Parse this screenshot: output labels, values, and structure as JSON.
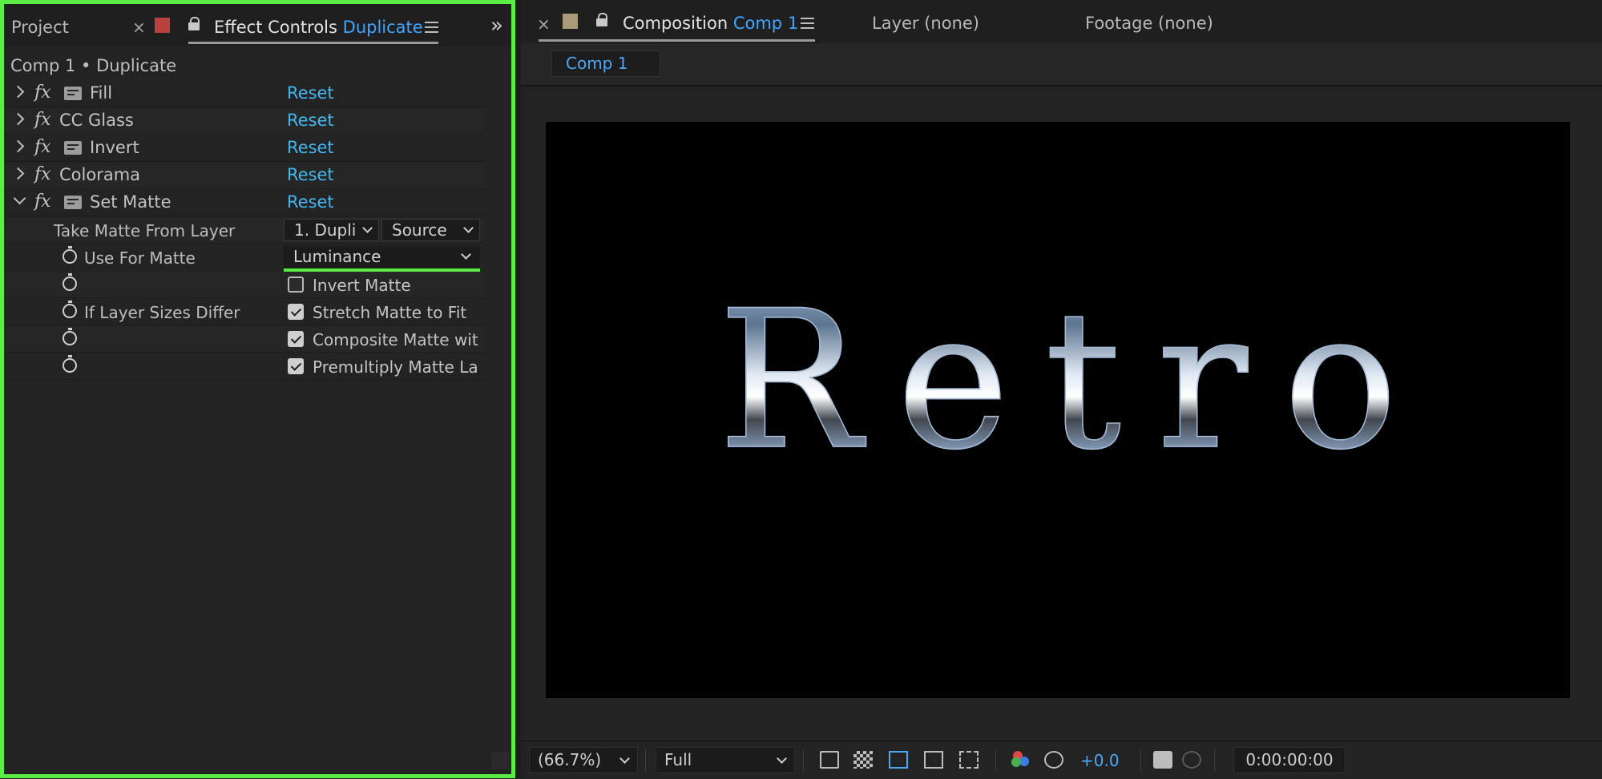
{
  "left_panel": {
    "tabs": {
      "project": "Project",
      "close_glyph": "×",
      "label_color": "#b8423f",
      "effect_controls_prefix": "Effect Controls",
      "effect_controls_layer": "Duplicate",
      "overflow_glyph": "»"
    },
    "header": "Comp 1 • Duplicate",
    "effects": [
      {
        "name": "Fill",
        "reset": "Reset",
        "expanded": false,
        "has_badge": true
      },
      {
        "name": "CC Glass",
        "reset": "Reset",
        "expanded": false,
        "has_badge": false
      },
      {
        "name": "Invert",
        "reset": "Reset",
        "expanded": false,
        "has_badge": true
      },
      {
        "name": "Colorama",
        "reset": "Reset",
        "expanded": false,
        "has_badge": false
      },
      {
        "name": "Set Matte",
        "reset": "Reset",
        "expanded": true,
        "has_badge": true
      }
    ],
    "fx_glyph": "fx",
    "set_matte": {
      "take_matte_label": "Take Matte From Layer",
      "layer_value": "1. Dupli",
      "source_value": "Source",
      "use_for_matte_label": "Use For Matte",
      "use_for_matte_value": "Luminance",
      "invert_matte": {
        "label": "Invert Matte",
        "checked": false
      },
      "if_sizes_label": "If Layer Sizes Differ",
      "stretch": {
        "label": "Stretch Matte to Fit",
        "checked": true
      },
      "composite": {
        "label": "Composite Matte wit",
        "checked": true
      },
      "premultiply": {
        "label": "Premultiply Matte La",
        "checked": true
      }
    },
    "highlight_color": "#5aee45"
  },
  "right_panel": {
    "tabs": {
      "close_glyph": "×",
      "label_color": "#a99a7a",
      "composition_prefix": "Composition",
      "composition_name": "Comp 1",
      "layer_tab": "Layer (none)",
      "footage_tab": "Footage (none)"
    },
    "subtab": "Comp 1",
    "viewer_text": "Retro",
    "bottom_bar": {
      "zoom": "(66.7%)",
      "resolution": "Full",
      "exposure": "+0.0",
      "timecode": "0:00:00:00"
    },
    "accent_color": "#3ea6ff"
  }
}
